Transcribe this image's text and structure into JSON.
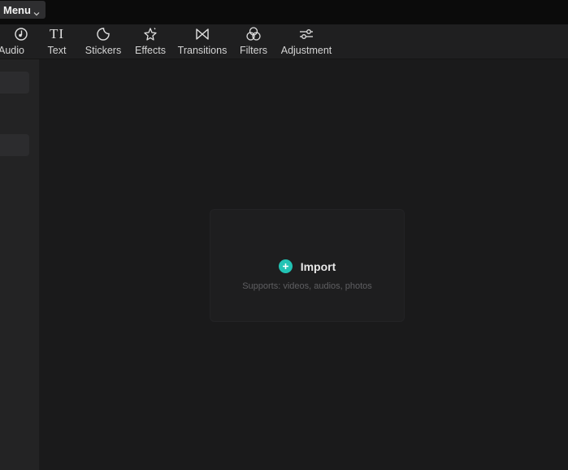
{
  "titlebar": {
    "menu_label": "Menu"
  },
  "toolbar": {
    "items": [
      {
        "label": "Audio",
        "icon": "audio-icon"
      },
      {
        "label": "Text",
        "icon": "text-icon"
      },
      {
        "label": "Stickers",
        "icon": "stickers-icon"
      },
      {
        "label": "Effects",
        "icon": "effects-icon"
      },
      {
        "label": "Transitions",
        "icon": "transitions-icon"
      },
      {
        "label": "Filters",
        "icon": "filters-icon"
      },
      {
        "label": "Adjustment",
        "icon": "adjustment-icon"
      }
    ]
  },
  "text_icon_glyph": "TI",
  "main": {
    "import_label": "Import",
    "import_hint": "Supports: videos, audios, photos"
  },
  "colors": {
    "accent": "#22c3b4",
    "background": "#1a1a1b",
    "toolbar": "#1f1f20",
    "titlebar": "#0b0b0b"
  }
}
